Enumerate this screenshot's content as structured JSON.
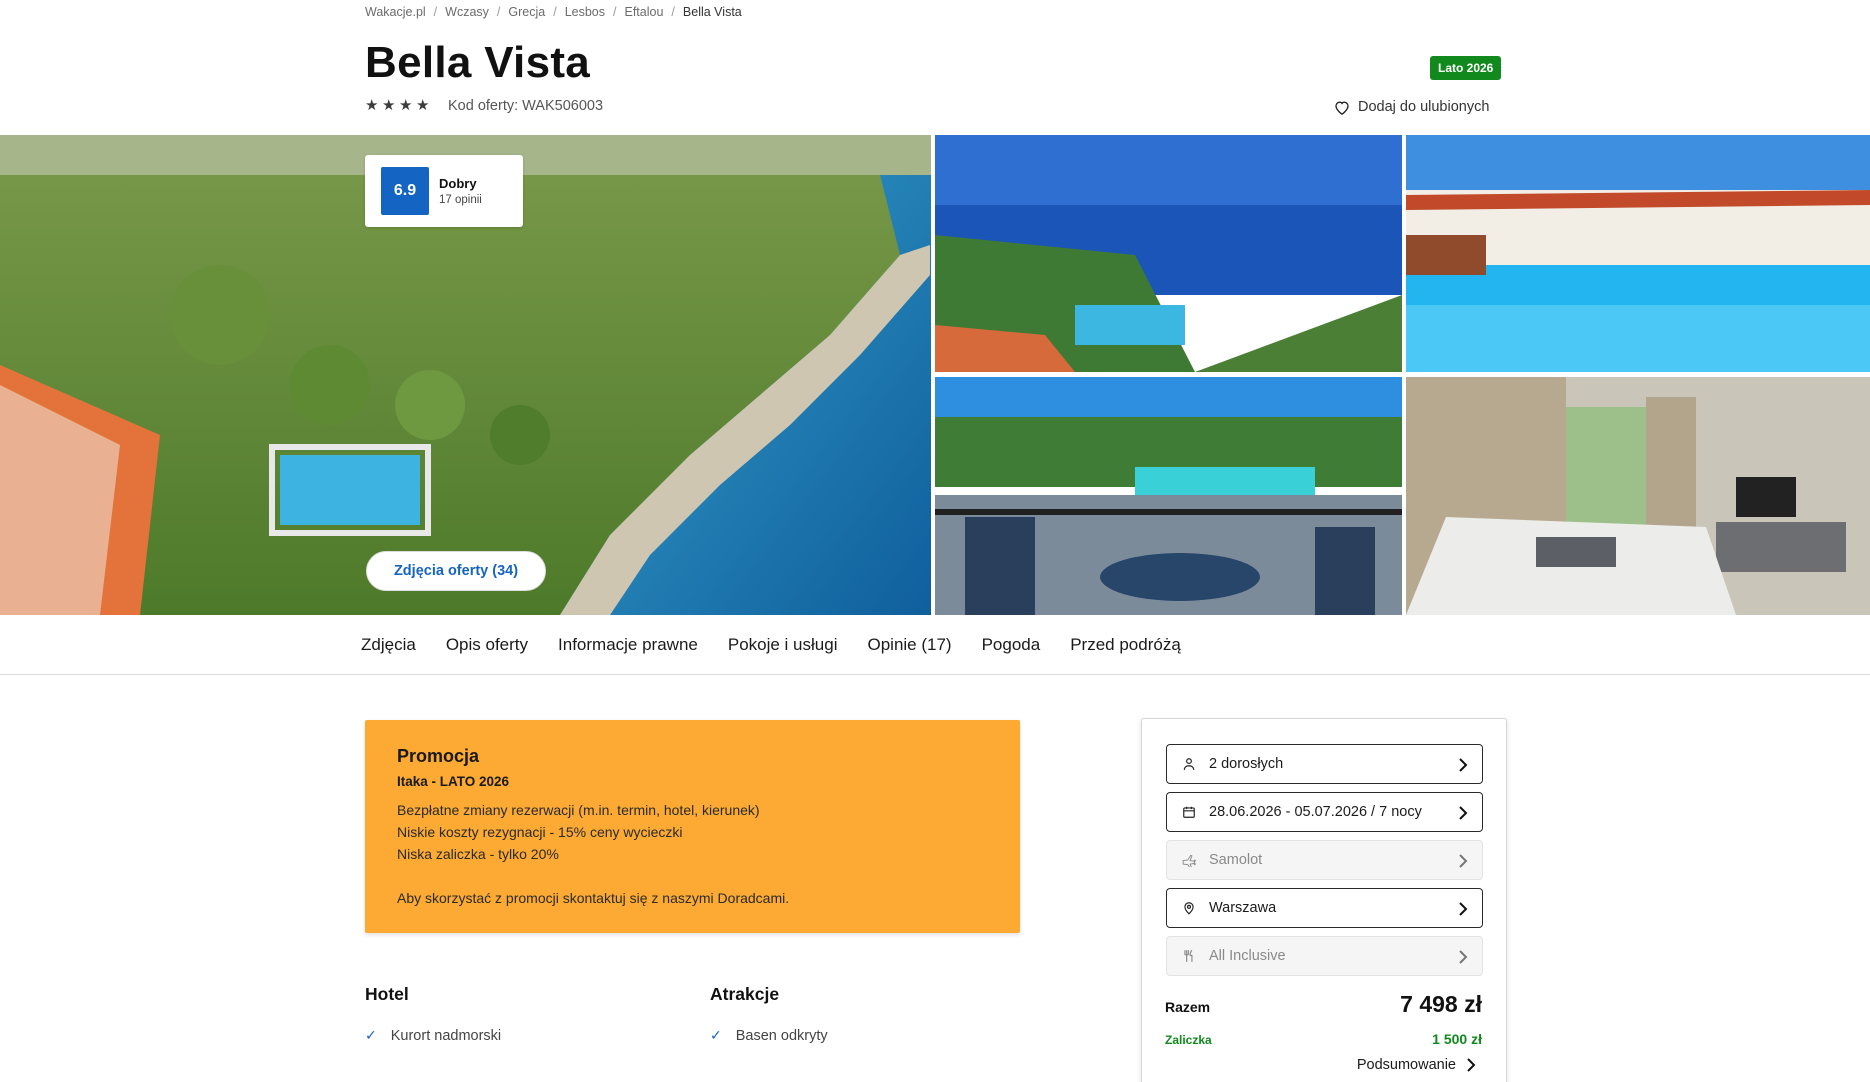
{
  "breadcrumb": [
    "Wakacje.pl",
    "Wczasy",
    "Grecja",
    "Lesbos",
    "Eftalou",
    "Bella Vista"
  ],
  "hotel": {
    "name": "Bella Vista",
    "stars": 4,
    "offer_code": "Kod oferty: WAK506003",
    "season_badge": "Lato 2026",
    "favorite_label": "Dodaj do ulubionych"
  },
  "rating": {
    "score": "6.9",
    "label": "Dobry",
    "count": "17 opinii"
  },
  "gallery": {
    "photos_button": "Zdjęcia oferty (34)"
  },
  "tabs": [
    "Zdjęcia",
    "Opis oferty",
    "Informacje prawne",
    "Pokoje i usługi",
    "Opinie (17)",
    "Pogoda",
    "Przed podróżą"
  ],
  "promo": {
    "title": "Promocja",
    "subtitle": "Itaka - LATO 2026",
    "lines": [
      "Bezpłatne zmiany rezerwacji (m.in. termin, hotel, kierunek)",
      "Niskie koszty rezygnacji - 15% ceny wycieczki",
      "Niska zaliczka - tylko 20%"
    ],
    "note": "Aby skorzystać z promocji skontaktuj się z naszymi Doradcami."
  },
  "features": {
    "hotel_title": "Hotel",
    "hotel_items": [
      "Kurort nadmorski"
    ],
    "attractions_title": "Atrakcje",
    "attractions_items": [
      "Basen odkryty"
    ]
  },
  "booking": {
    "travellers": "2 dorosłych",
    "dates": "28.06.2026 - 05.07.2026 / 7 nocy",
    "transport": "Samolot",
    "departure": "Warszawa",
    "board": "All Inclusive",
    "total_label": "Razem",
    "total_value": "7 498 zł",
    "deposit_label": "Zaliczka",
    "deposit_value": "1 500 zł",
    "summary_label": "Podsumowanie"
  },
  "colors": {
    "brand_blue": "#1464c4",
    "badge_green": "#11891d",
    "promo_orange": "#fcaa33"
  }
}
